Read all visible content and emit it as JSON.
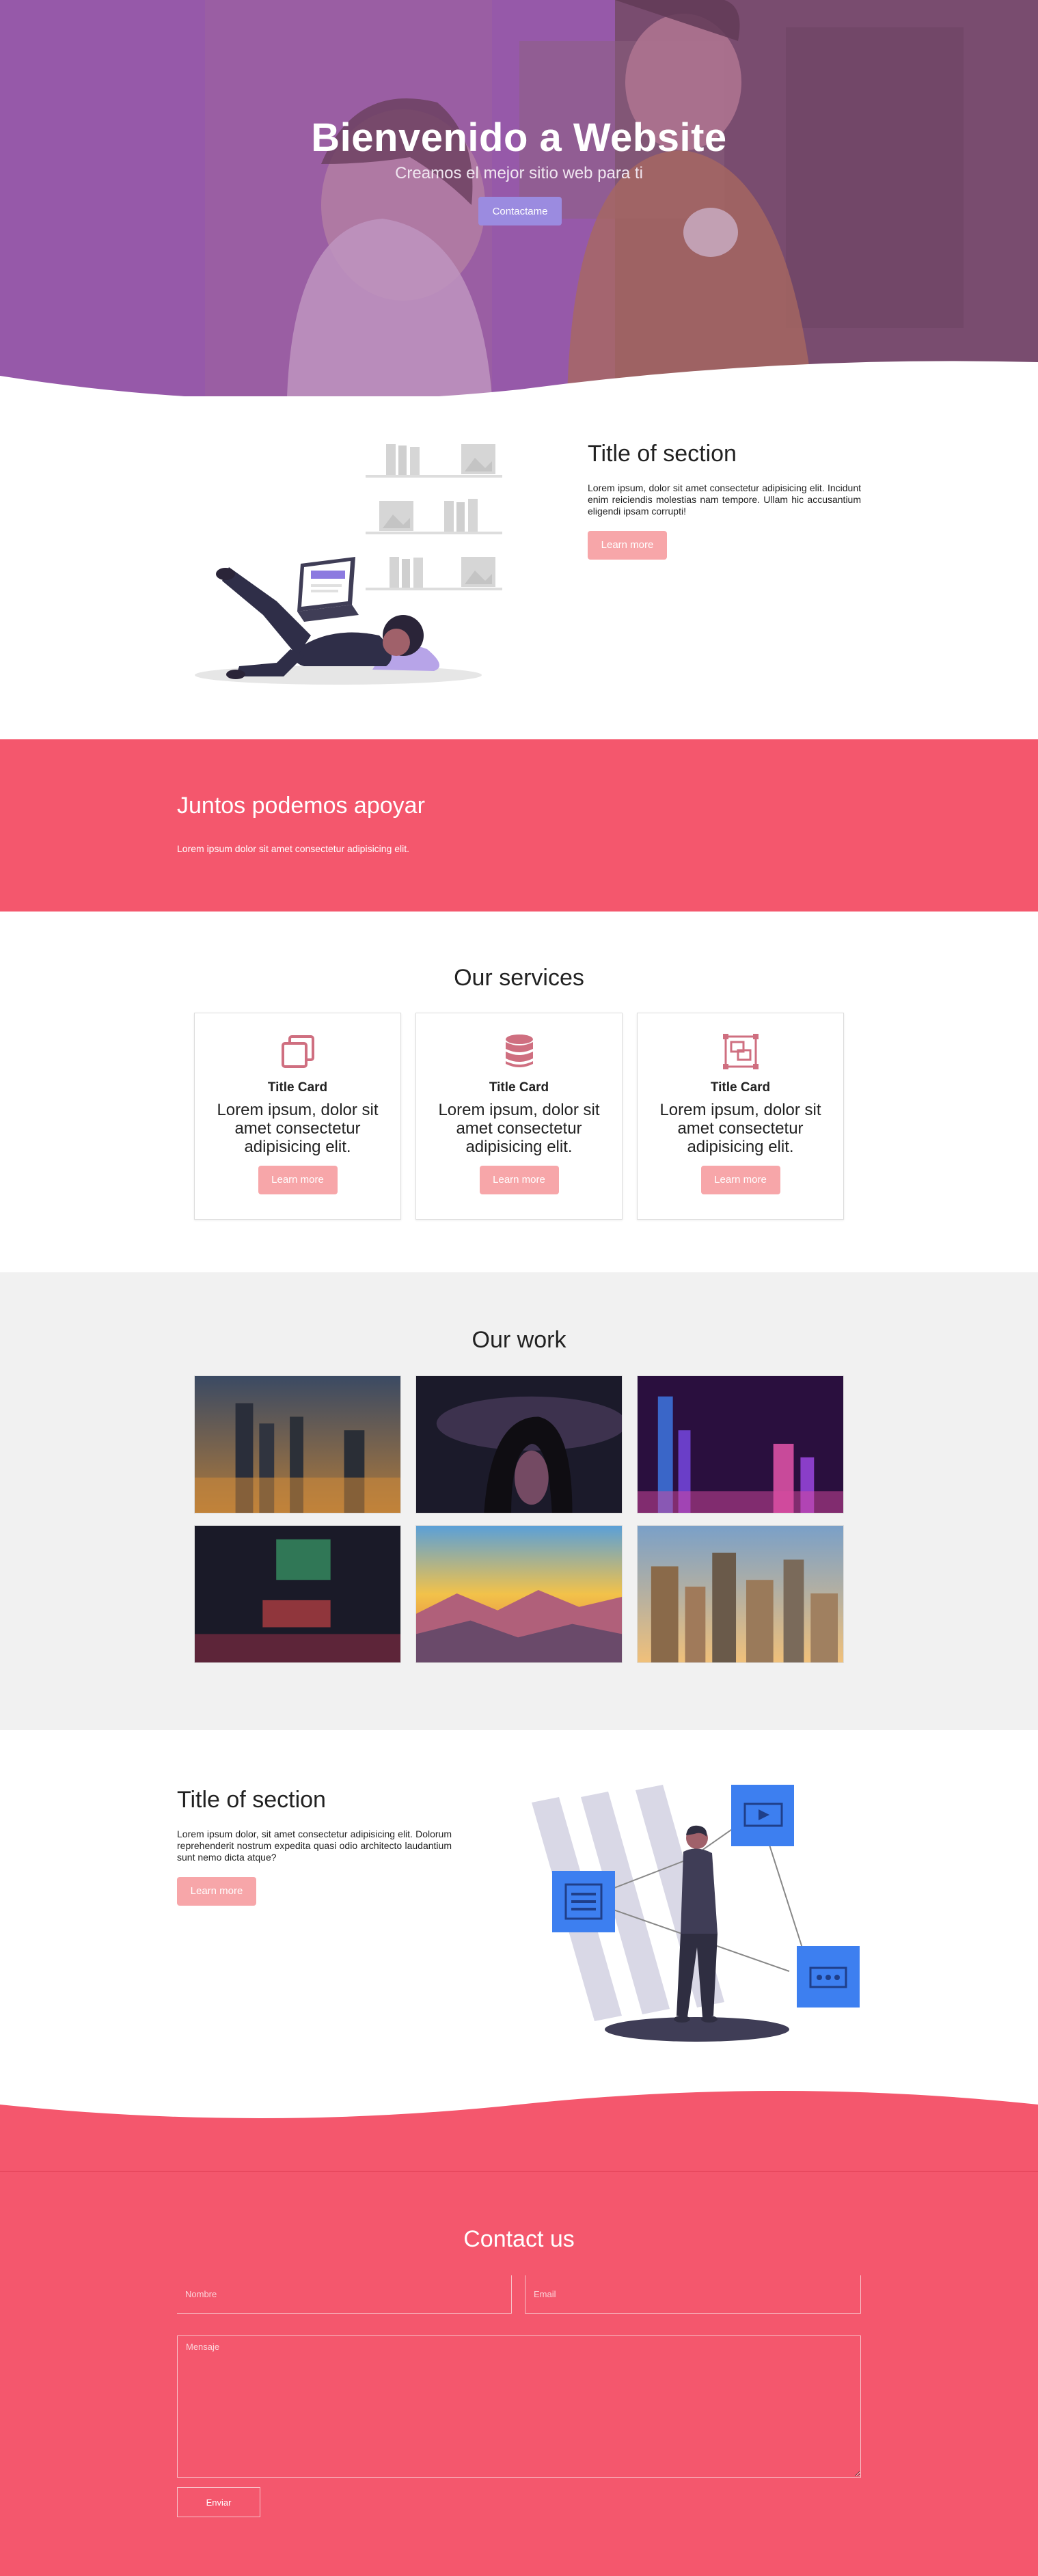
{
  "hero": {
    "title": "Bienvenido a Website",
    "subtitle": "Creamos el mejor sitio web para ti",
    "button_label": "Contactame"
  },
  "section1": {
    "title": "Title of section",
    "body": "Lorem ipsum, dolor sit amet consectetur adipisicing elit. Incidunt enim reiciendis molestias nam tempore. Ullam hic accusantium eligendi ipsam corrupti!",
    "button_label": "Learn more"
  },
  "band": {
    "title": "Juntos podemos apoyar",
    "body": "Lorem ipsum dolor sit amet consectetur adipisicing elit."
  },
  "services": {
    "title": "Our services",
    "cards": [
      {
        "icon": "copy-icon",
        "title": "Title Card",
        "body": "Lorem ipsum, dolor sit amet consectetur adipisicing elit.",
        "button_label": "Learn more"
      },
      {
        "icon": "database-icon",
        "title": "Title Card",
        "body": "Lorem ipsum, dolor sit amet consectetur adipisicing elit.",
        "button_label": "Learn more"
      },
      {
        "icon": "object-group-icon",
        "title": "Title Card",
        "body": "Lorem ipsum, dolor sit amet consectetur adipisicing elit.",
        "button_label": "Learn more"
      }
    ]
  },
  "work": {
    "title": "Our work"
  },
  "section2": {
    "title": "Title of section",
    "body": "Lorem ipsum dolor, sit amet consectetur adipisicing elit. Dolorum reprehenderit nostrum expedita quasi odio architecto laudantium sunt nemo dicta atque?",
    "button_label": "Learn more"
  },
  "contact": {
    "title": "Contact us",
    "name_placeholder": "Nombre",
    "email_placeholder": "Email",
    "message_placeholder": "Mensaje",
    "send_label": "Enviar"
  },
  "colors": {
    "accent_pink": "#f4576d",
    "button_pink": "#f7a6a9",
    "hero_button": "#9b8be0",
    "illustration_purple": "#8c7ae0",
    "illustration_blue": "#3d7ff0"
  }
}
